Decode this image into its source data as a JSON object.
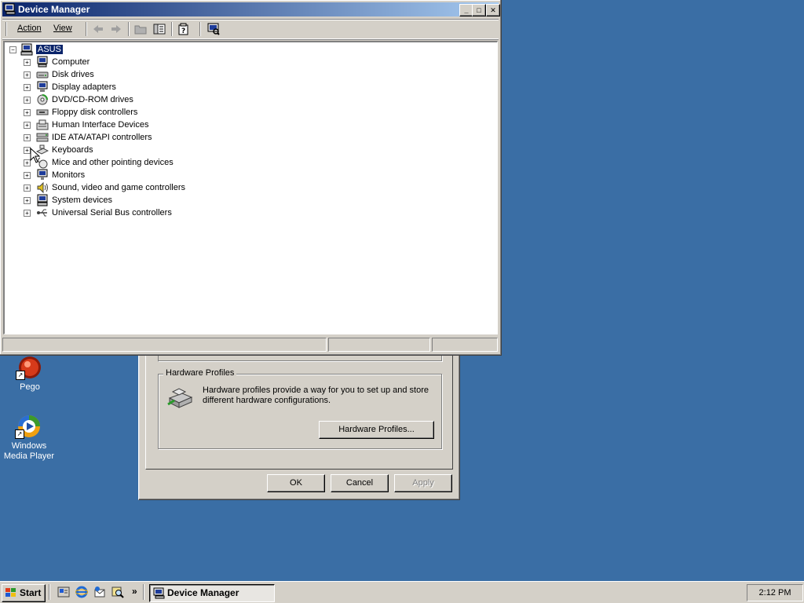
{
  "desktop": {
    "icons": [
      {
        "label": "Pego",
        "icon": "pego-icon"
      },
      {
        "label": "Windows\nMedia Player",
        "label_lines": [
          "Windows",
          "Media Player"
        ],
        "icon": "media-player-icon"
      }
    ]
  },
  "system_properties": {
    "hardware_profiles": {
      "group_title": "Hardware Profiles",
      "description": "Hardware profiles provide a way for you to set up and store different hardware configurations.",
      "button": "Hardware Profiles..."
    },
    "buttons": {
      "ok": "OK",
      "cancel": "Cancel",
      "apply": "Apply"
    }
  },
  "device_manager": {
    "title": "Device Manager",
    "menu": {
      "action": "Action",
      "view": "View"
    },
    "toolbar_icons": [
      "back-icon",
      "forward-icon",
      "up-folder-icon",
      "show-hide-tree-icon",
      "properties-help-icon",
      "scan-hardware-icon"
    ],
    "tree": {
      "root": "ASUS",
      "categories": [
        {
          "label": "Computer",
          "icon": "computer-icon"
        },
        {
          "label": "Disk drives",
          "icon": "disk-drive-icon"
        },
        {
          "label": "Display adapters",
          "icon": "display-adapter-icon"
        },
        {
          "label": "DVD/CD-ROM drives",
          "icon": "cdrom-icon"
        },
        {
          "label": "Floppy disk controllers",
          "icon": "floppy-controller-icon"
        },
        {
          "label": "Human Interface Devices",
          "icon": "hid-icon"
        },
        {
          "label": "IDE ATA/ATAPI controllers",
          "icon": "ide-controller-icon"
        },
        {
          "label": "Keyboards",
          "icon": "keyboard-icon"
        },
        {
          "label": "Mice and other pointing devices",
          "icon": "mouse-icon"
        },
        {
          "label": "Monitors",
          "icon": "monitor-icon"
        },
        {
          "label": "Sound, video and game controllers",
          "icon": "sound-icon"
        },
        {
          "label": "System devices",
          "icon": "system-device-icon"
        },
        {
          "label": "Universal Serial Bus controllers",
          "icon": "usb-icon"
        }
      ]
    }
  },
  "taskbar": {
    "start": "Start",
    "quick_launch": [
      "show-desktop-icon",
      "internet-explorer-icon",
      "outlook-express-icon",
      "search-icon"
    ],
    "chevron": "»",
    "tasks": [
      {
        "label": "Device Manager",
        "active": true
      }
    ],
    "clock": "2:12 PM"
  },
  "colors": {
    "desktop": "#3a6ea5",
    "titlebar_start": "#0a246a",
    "titlebar_end": "#a6caf0",
    "face": "#d4d0c8",
    "selection": "#0a246a"
  }
}
